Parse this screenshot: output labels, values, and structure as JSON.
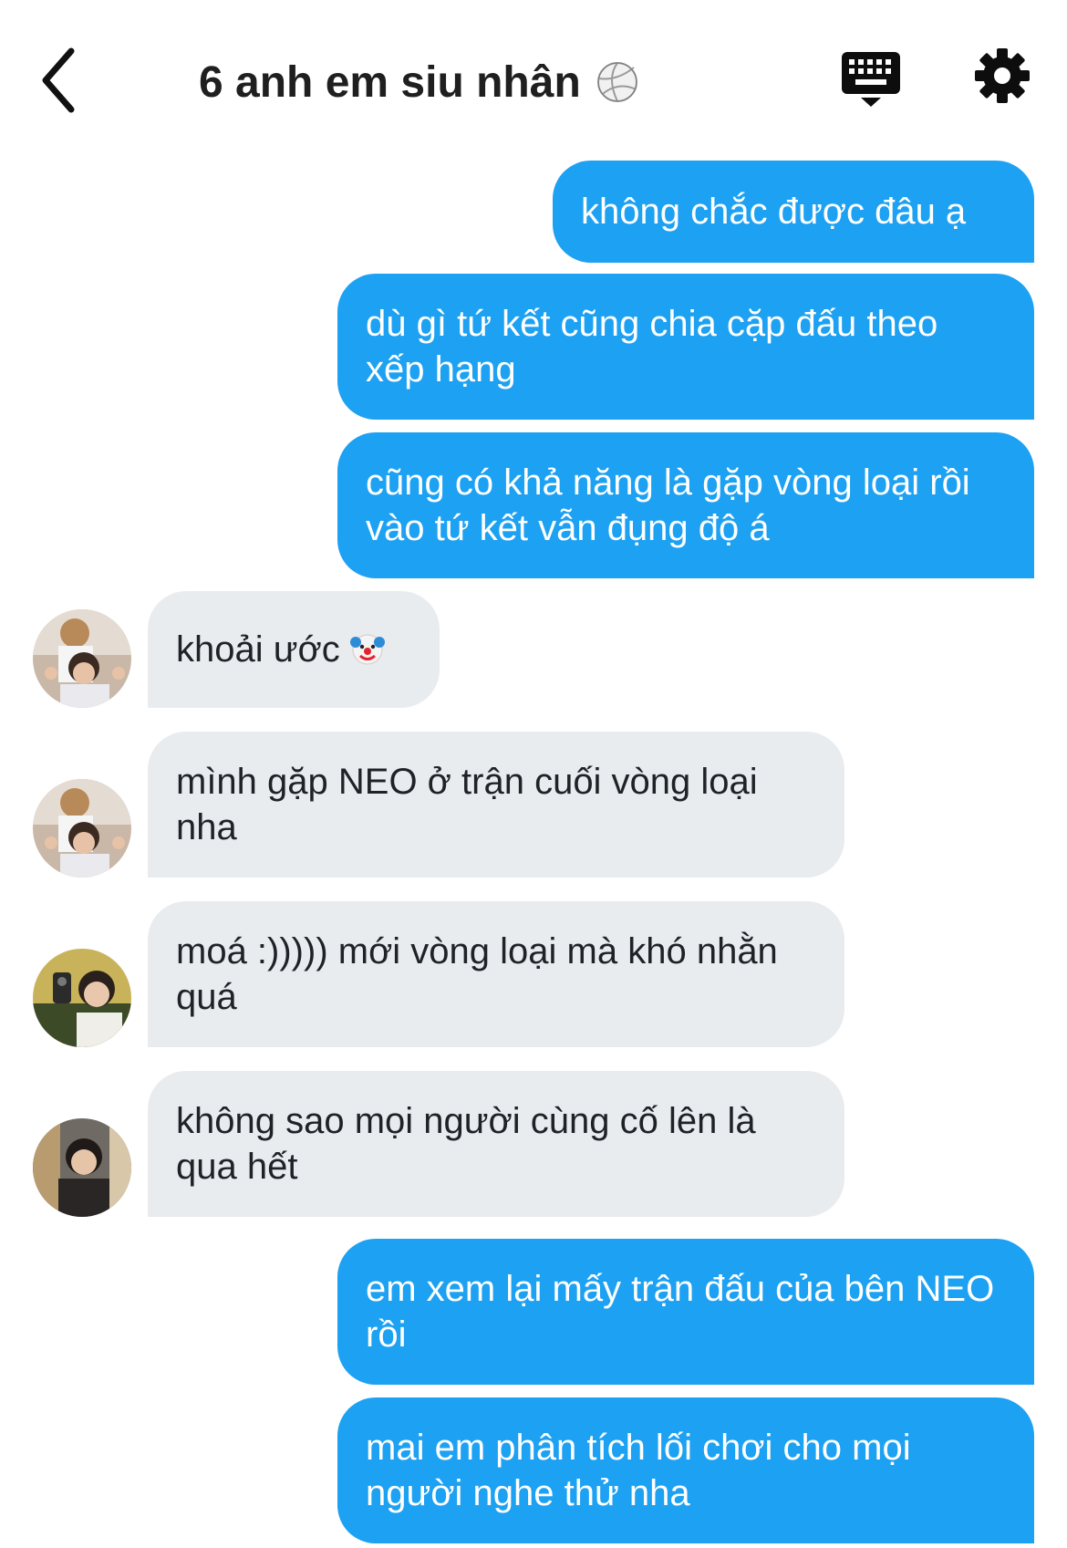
{
  "header": {
    "title": "6 anh em siu nhân",
    "title_emoji": "volleyball-emoji",
    "back_icon": "chevron-left-icon",
    "keyboard_icon": "keyboard-icon",
    "settings_icon": "gear-icon"
  },
  "messages": [
    {
      "direction": "out",
      "text": "không chắc được đâu ạ"
    },
    {
      "direction": "out",
      "text": "dù gì tứ kết cũng chia cặp đấu theo xếp hạng"
    },
    {
      "direction": "out",
      "text": "cũng có khả năng là gặp vòng loại rồi vào tứ kết vẫn đụng độ á"
    },
    {
      "direction": "in",
      "text": "khoải ước",
      "emoji": "clown-face-emoji"
    },
    {
      "direction": "in",
      "text": "mình gặp NEO ở trận cuối vòng loại nha"
    },
    {
      "direction": "in",
      "text": "moá :))))) mới vòng loại mà khó nhằn quá"
    },
    {
      "direction": "in",
      "text": "không sao mọi người cùng cố lên là qua hết"
    },
    {
      "direction": "out",
      "text": "em xem lại mấy trận đấu của bên NEO rồi"
    },
    {
      "direction": "out",
      "text": "mai em phân tích lối chơi cho mọi người nghe thử nha"
    }
  ],
  "colors": {
    "outgoing_bubble": "#1da1f2",
    "incoming_bubble": "#e9ecef",
    "title_text": "#1f1f1f"
  }
}
